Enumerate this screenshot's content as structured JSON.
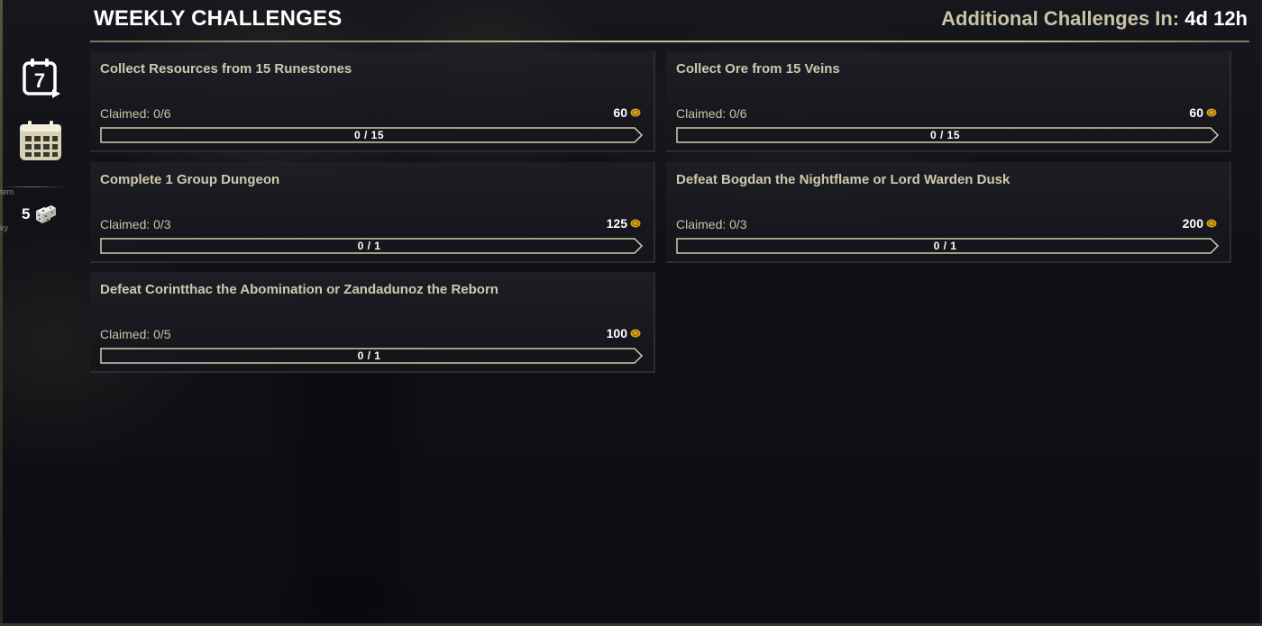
{
  "header": {
    "title": "WEEKLY CHALLENGES",
    "timer_label": "Additional Challenges In:",
    "timer_value": "4d 12h"
  },
  "sidebar": {
    "icons": [
      "daily-seven-icon",
      "calendar-icon"
    ],
    "cutoff_text_1": "tem",
    "cutoff_text_2": "ky",
    "dice_count": "5"
  },
  "colors": {
    "title": "#ffffff",
    "card_title": "#cfc9ac",
    "accent_gold": "#c2bc9d",
    "coin": "#d9a21a"
  },
  "challenges": [
    {
      "title": "Collect Resources from 15 Runestones",
      "claimed": "Claimed: 0/6",
      "reward": "60",
      "progress_text": "0 / 15",
      "progress": 0
    },
    {
      "title": "Collect Ore from 15 Veins",
      "claimed": "Claimed: 0/6",
      "reward": "60",
      "progress_text": "0 / 15",
      "progress": 0
    },
    {
      "title": "Complete 1 Group Dungeon",
      "claimed": "Claimed: 0/3",
      "reward": "125",
      "progress_text": "0 / 1",
      "progress": 0
    },
    {
      "title": "Defeat Bogdan the Nightflame or Lord Warden Dusk",
      "claimed": "Claimed: 0/3",
      "reward": "200",
      "progress_text": "0 / 1",
      "progress": 0
    },
    {
      "title": "Defeat Corintthac the Abomination or Zandadunoz the Reborn",
      "claimed": "Claimed: 0/5",
      "reward": "100",
      "progress_text": "0 / 1",
      "progress": 0
    }
  ]
}
